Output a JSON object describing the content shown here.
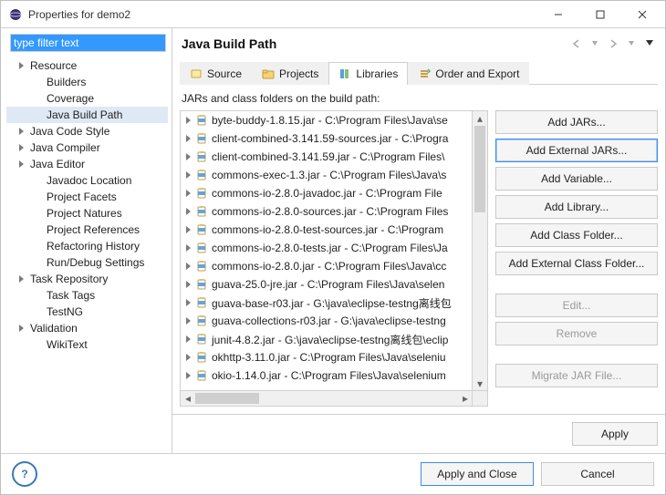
{
  "window": {
    "title": "Properties for demo2"
  },
  "filter": {
    "value": "type filter text"
  },
  "tree": [
    {
      "label": "Resource",
      "expandable": true,
      "indent": 1
    },
    {
      "label": "Builders",
      "expandable": false,
      "indent": 2
    },
    {
      "label": "Coverage",
      "expandable": false,
      "indent": 2
    },
    {
      "label": "Java Build Path",
      "expandable": false,
      "indent": 2,
      "selected": true
    },
    {
      "label": "Java Code Style",
      "expandable": true,
      "indent": 1
    },
    {
      "label": "Java Compiler",
      "expandable": true,
      "indent": 1
    },
    {
      "label": "Java Editor",
      "expandable": true,
      "indent": 1
    },
    {
      "label": "Javadoc Location",
      "expandable": false,
      "indent": 2
    },
    {
      "label": "Project Facets",
      "expandable": false,
      "indent": 2
    },
    {
      "label": "Project Natures",
      "expandable": false,
      "indent": 2
    },
    {
      "label": "Project References",
      "expandable": false,
      "indent": 2
    },
    {
      "label": "Refactoring History",
      "expandable": false,
      "indent": 2
    },
    {
      "label": "Run/Debug Settings",
      "expandable": false,
      "indent": 2
    },
    {
      "label": "Task Repository",
      "expandable": true,
      "indent": 1
    },
    {
      "label": "Task Tags",
      "expandable": false,
      "indent": 2
    },
    {
      "label": "TestNG",
      "expandable": false,
      "indent": 2
    },
    {
      "label": "Validation",
      "expandable": true,
      "indent": 1
    },
    {
      "label": "WikiText",
      "expandable": false,
      "indent": 2
    }
  ],
  "page": {
    "title": "Java Build Path",
    "tabs": [
      {
        "label": "Source",
        "icon": "source"
      },
      {
        "label": "Projects",
        "icon": "projects"
      },
      {
        "label": "Libraries",
        "icon": "libraries",
        "active": true
      },
      {
        "label": "Order and Export",
        "icon": "order"
      }
    ],
    "description": "JARs and class folders on the build path:",
    "jars": [
      "byte-buddy-1.8.15.jar - C:\\Program Files\\Java\\se",
      "client-combined-3.141.59-sources.jar - C:\\Progra",
      "client-combined-3.141.59.jar - C:\\Program Files\\",
      "commons-exec-1.3.jar - C:\\Program Files\\Java\\s",
      "commons-io-2.8.0-javadoc.jar - C:\\Program File",
      "commons-io-2.8.0-sources.jar - C:\\Program Files",
      "commons-io-2.8.0-test-sources.jar - C:\\Program",
      "commons-io-2.8.0-tests.jar - C:\\Program Files\\Ja",
      "commons-io-2.8.0.jar - C:\\Program Files\\Java\\cc",
      "guava-25.0-jre.jar - C:\\Program Files\\Java\\selen",
      "guava-base-r03.jar - G:\\java\\eclipse-testng离线包",
      "guava-collections-r03.jar - G:\\java\\eclipse-testng",
      "junit-4.8.2.jar - G:\\java\\eclipse-testng离线包\\eclip",
      "okhttp-3.11.0.jar - C:\\Program Files\\Java\\seleniu",
      "okio-1.14.0.jar - C:\\Program Files\\Java\\selenium"
    ],
    "buttons": [
      {
        "label": "Add JARs...",
        "state": "normal"
      },
      {
        "label": "Add External JARs...",
        "state": "selected"
      },
      {
        "label": "Add Variable...",
        "state": "normal"
      },
      {
        "label": "Add Library...",
        "state": "normal"
      },
      {
        "label": "Add Class Folder...",
        "state": "normal"
      },
      {
        "label": "Add External Class Folder...",
        "state": "normal"
      },
      {
        "label": "Edit...",
        "state": "disabled",
        "gapBefore": true
      },
      {
        "label": "Remove",
        "state": "disabled"
      },
      {
        "label": "Migrate JAR File...",
        "state": "disabled",
        "gapBefore": true
      }
    ],
    "apply": "Apply"
  },
  "footer": {
    "applyClose": "Apply and Close",
    "cancel": "Cancel"
  }
}
